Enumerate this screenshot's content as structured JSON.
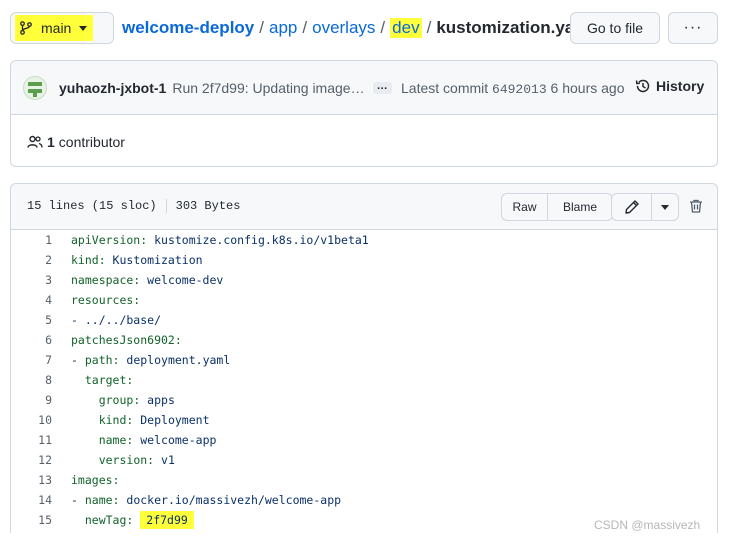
{
  "branch": {
    "name": "main"
  },
  "breadcrumb": {
    "repo": "welcome-deploy",
    "sep": "/",
    "parts": [
      "app",
      "overlays",
      "dev"
    ],
    "file": "kustomization.yaml"
  },
  "actions": {
    "go_to_file": "Go to file",
    "more": "···"
  },
  "commit": {
    "author": "yuhaozh-jxbot-1",
    "message": "Run 2f7d99: Updating image…",
    "ellipsis": "…",
    "latest_label": "Latest commit",
    "sha": "6492013",
    "time": "6 hours ago",
    "history_label": "History"
  },
  "contributors": {
    "count": "1",
    "label": "contributor"
  },
  "file": {
    "lines_info": "15 lines (15 sloc)",
    "size": "303 Bytes",
    "raw_label": "Raw",
    "blame_label": "Blame"
  },
  "code_lines": [
    {
      "n": "1",
      "text": "apiVersion: kustomize.config.k8s.io/v1beta1"
    },
    {
      "n": "2",
      "text": "kind: Kustomization"
    },
    {
      "n": "3",
      "text": "namespace: welcome-dev"
    },
    {
      "n": "4",
      "text": "resources:"
    },
    {
      "n": "5",
      "text": "- ../../base/"
    },
    {
      "n": "6",
      "text": "patchesJson6902:"
    },
    {
      "n": "7",
      "text": "- path: deployment.yaml"
    },
    {
      "n": "8",
      "text": "  target:"
    },
    {
      "n": "9",
      "text": "    group: apps"
    },
    {
      "n": "10",
      "text": "    kind: Deployment"
    },
    {
      "n": "11",
      "text": "    name: welcome-app"
    },
    {
      "n": "12",
      "text": "    version: v1"
    },
    {
      "n": "13",
      "text": "images:"
    },
    {
      "n": "14",
      "text": "- name: docker.io/massivezh/welcome-app"
    },
    {
      "n": "15",
      "text": "  newTag: ",
      "highlight": "2f7d99"
    }
  ],
  "watermark": "CSDN @massivezh",
  "colors": {
    "link": "#0969da",
    "highlight": "#ffff3a",
    "border": "#d0d7de"
  },
  "icons": [
    "git-branch-icon",
    "history-icon",
    "people-icon",
    "pencil-icon",
    "trash-icon"
  ]
}
